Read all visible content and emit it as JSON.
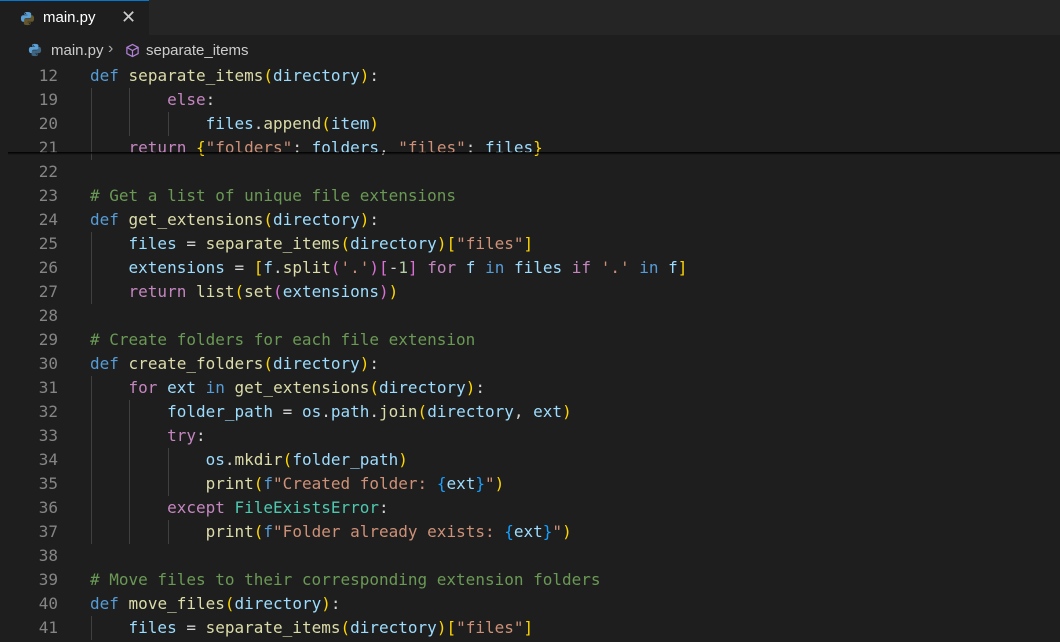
{
  "tab": {
    "filename": "main.py",
    "close_glyph": "✕",
    "icon": "python-icon"
  },
  "breadcrumb": {
    "file": "main.py",
    "separator": "›",
    "symbol": "separate_items",
    "symbol_icon": "cube-icon"
  },
  "colors": {
    "keyword": "#569cd6",
    "function": "#dcdcaa",
    "string": "#ce9178",
    "comment": "#6a9955",
    "control": "#c586c0",
    "accent": "#0078d4"
  },
  "lines": [
    {
      "n": "12",
      "text": "def separate_items(directory):"
    },
    {
      "n": "19",
      "text": "        else:"
    },
    {
      "n": "20",
      "text": "            files.append(item)"
    },
    {
      "n": "21",
      "text": "    return {\"folders\": folders, \"files\": files}"
    },
    {
      "n": "22",
      "text": ""
    },
    {
      "n": "23",
      "text": "# Get a list of unique file extensions"
    },
    {
      "n": "24",
      "text": "def get_extensions(directory):"
    },
    {
      "n": "25",
      "text": "    files = separate_items(directory)[\"files\"]"
    },
    {
      "n": "26",
      "text": "    extensions = [f.split('.')[-1] for f in files if '.' in f]"
    },
    {
      "n": "27",
      "text": "    return list(set(extensions))"
    },
    {
      "n": "28",
      "text": ""
    },
    {
      "n": "29",
      "text": "# Create folders for each file extension"
    },
    {
      "n": "30",
      "text": "def create_folders(directory):"
    },
    {
      "n": "31",
      "text": "    for ext in get_extensions(directory):"
    },
    {
      "n": "32",
      "text": "        folder_path = os.path.join(directory, ext)"
    },
    {
      "n": "33",
      "text": "        try:"
    },
    {
      "n": "34",
      "text": "            os.mkdir(folder_path)"
    },
    {
      "n": "35",
      "text": "            print(f\"Created folder: {ext}\")"
    },
    {
      "n": "36",
      "text": "        except FileExistsError:"
    },
    {
      "n": "37",
      "text": "            print(f\"Folder already exists: {ext}\")"
    },
    {
      "n": "38",
      "text": ""
    },
    {
      "n": "39",
      "text": "# Move files to their corresponding extension folders"
    },
    {
      "n": "40",
      "text": "def move_files(directory):"
    },
    {
      "n": "41",
      "text": "    files = separate_items(directory)[\"files\"]"
    }
  ]
}
